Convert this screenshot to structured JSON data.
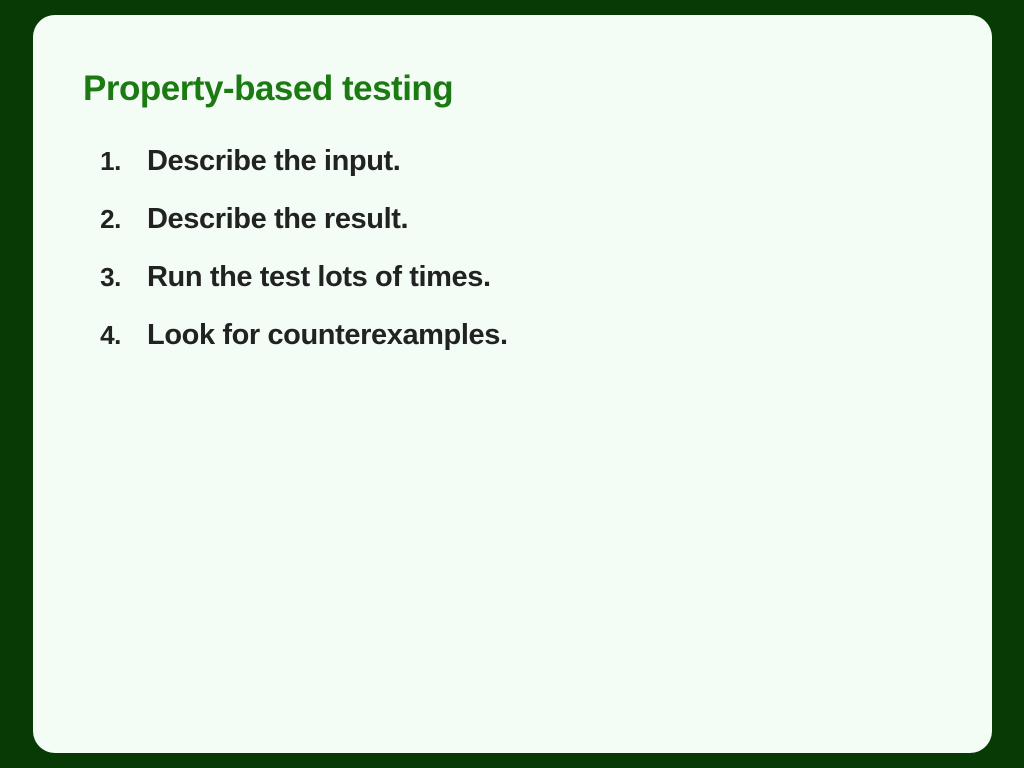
{
  "slide": {
    "title": "Property-based testing",
    "steps": [
      {
        "number": "1.",
        "text": "Describe the input."
      },
      {
        "number": "2.",
        "text": "Describe the result."
      },
      {
        "number": "3.",
        "text": "Run the test lots of times."
      },
      {
        "number": "4.",
        "text": "Look for counterexamples."
      }
    ]
  },
  "colors": {
    "frame": "#073a04",
    "slide_background": "#f3fdf6",
    "title": "#1c7a12",
    "body_text": "#222222"
  }
}
